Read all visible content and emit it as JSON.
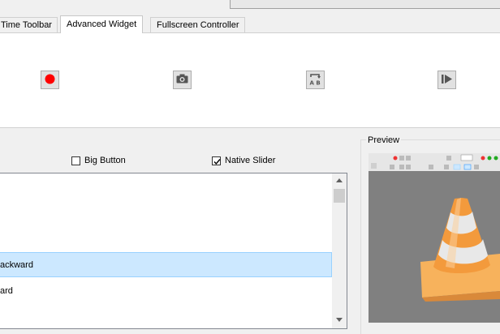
{
  "tabs": [
    {
      "label": "Time Toolbar",
      "active": false
    },
    {
      "label": "Advanced Widget",
      "active": true
    },
    {
      "label": "Fullscreen Controller",
      "active": false
    }
  ],
  "tool_buttons": [
    {
      "icon": "record-icon",
      "accent": "#ff0000"
    },
    {
      "icon": "snapshot-icon"
    },
    {
      "icon": "ab-loop-icon",
      "text": "A B"
    },
    {
      "icon": "frame-by-frame-icon"
    }
  ],
  "options": {
    "big_button": {
      "label": "Big Button",
      "checked": false
    },
    "native_slider": {
      "label": "Native Slider",
      "checked": true
    }
  },
  "list": {
    "items": [
      {
        "label": "ackward",
        "selected": true
      },
      {
        "label": "ard",
        "selected": false
      }
    ]
  },
  "preview": {
    "title": "Preview",
    "background": "#808080"
  }
}
